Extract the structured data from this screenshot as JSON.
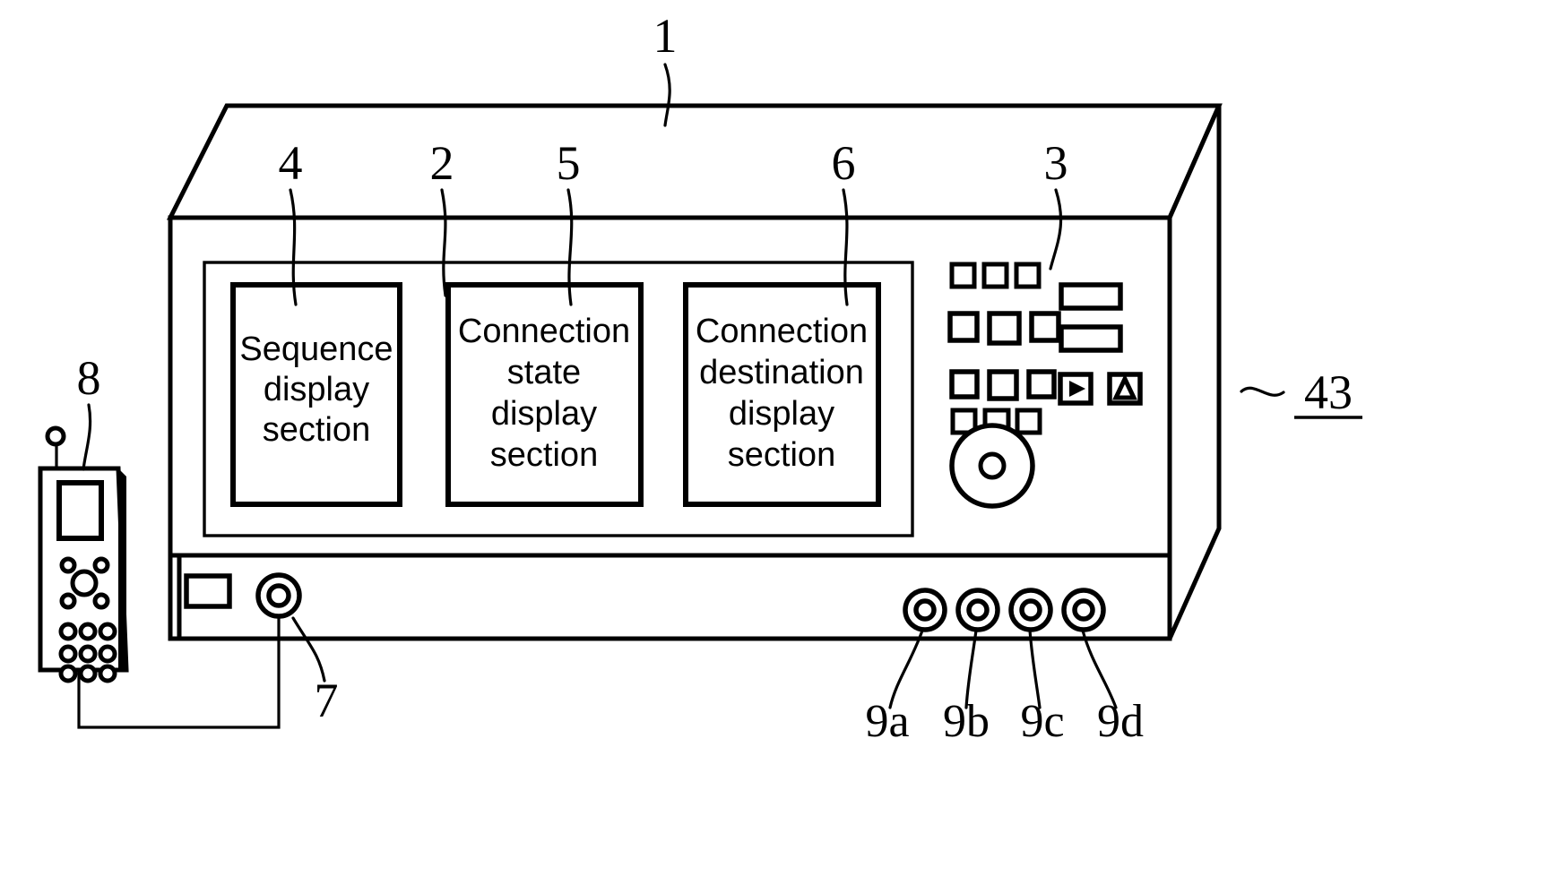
{
  "figure": {
    "type": "patent-figure",
    "description": "Front view of a measurement/communication apparatus with three display sections, a keypad control area, a dial knob, connector jacks and an attached handheld terminal."
  },
  "reference_numerals": {
    "device_body": "1",
    "display_panel": "2",
    "control_panel": "3",
    "sequence_display": "4",
    "connection_state_display": "5",
    "connection_destination_display": "6",
    "antenna_connector": "7",
    "handheld_terminal": "8",
    "jack_a": "9a",
    "jack_b": "9b",
    "jack_c": "9c",
    "jack_d": "9d",
    "side_label": "43"
  },
  "displays": [
    {
      "id": "sequence",
      "lines": [
        "Sequence",
        "display",
        "section"
      ]
    },
    {
      "id": "state",
      "lines": [
        "Connection",
        "state",
        "display",
        "section"
      ]
    },
    {
      "id": "destination",
      "lines": [
        "Connection",
        "destination",
        "display",
        "section"
      ]
    }
  ],
  "control_panel": {
    "keypad_rows": [
      {
        "count": 3,
        "size": "small"
      },
      {
        "count": 3,
        "size": "large"
      },
      {
        "count": 3,
        "size": "medium"
      },
      {
        "count": 3,
        "size": "small"
      }
    ],
    "side_buttons": [
      {
        "id": "wide-button-1",
        "shape": "wide-rect",
        "label": ""
      },
      {
        "id": "wide-button-2",
        "shape": "wide-rect",
        "label": ""
      },
      {
        "id": "play-button",
        "shape": "square",
        "icon": "play-triangle-icon",
        "glyph": "▷"
      },
      {
        "id": "up-button",
        "shape": "square",
        "icon": "up-triangle-icon",
        "glyph": "△"
      }
    ],
    "dial": {
      "id": "rotary-dial",
      "icon": "dial-knob-icon"
    }
  },
  "handheld": {
    "antenna": true,
    "screen": true,
    "nav_cluster_dots": 4,
    "center_button": true,
    "keypad_dot_rows": 3,
    "keypad_dots_per_row": 3,
    "cable": true
  },
  "jacks": [
    {
      "label": "9a"
    },
    {
      "label": "9b"
    },
    {
      "label": "9c"
    },
    {
      "label": "9d"
    }
  ],
  "colors": {
    "ink": "#000000",
    "paper": "#ffffff"
  }
}
